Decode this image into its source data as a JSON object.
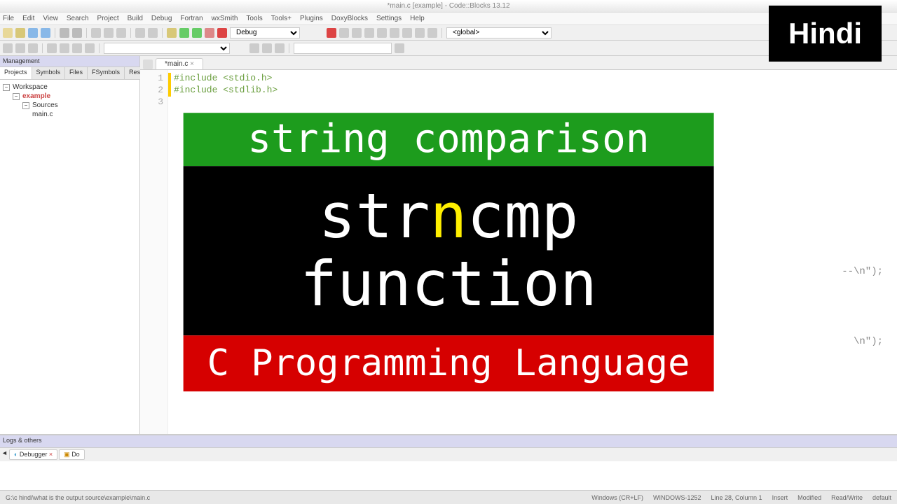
{
  "titlebar": "*main.c [example] - Code::Blocks 13.12",
  "menu": [
    "File",
    "Edit",
    "View",
    "Search",
    "Project",
    "Build",
    "Debug",
    "Fortran",
    "wxSmith",
    "Tools",
    "Tools+",
    "Plugins",
    "DoxyBlocks",
    "Settings",
    "Help"
  ],
  "toolbar": {
    "debug_dropdown": "Debug",
    "global_dropdown": "<global>"
  },
  "sidebar": {
    "header": "Management",
    "tabs": [
      "Projects",
      "Symbols",
      "Files",
      "FSymbols",
      "Resources"
    ],
    "active_tab": 0,
    "tree": {
      "root": "Workspace",
      "project": "example",
      "folder": "Sources",
      "file": "main.c"
    }
  },
  "editor": {
    "tab": "*main.c",
    "lines": [
      "1",
      "2",
      "3"
    ],
    "code": [
      "#include <stdio.h>",
      "#include <stdlib.h>",
      ""
    ]
  },
  "code_fragments": {
    "frag1": "--\\n\");",
    "frag2": "\\n\");"
  },
  "bottom": {
    "header": "Logs & others",
    "tabs": [
      "Debugger",
      "Do"
    ]
  },
  "statusbar": {
    "left": "G:\\c hindi\\what is the output source\\example\\main.c",
    "encoding": "Windows (CR+LF)",
    "charset": "WINDOWS-1252",
    "pos": "Line 28, Column 1",
    "insert": "Insert",
    "modified": "Modified",
    "rw": "Read/Write",
    "profile": "default"
  },
  "overlay": {
    "green": "string comparison",
    "black_pre": "str",
    "black_hl": "n",
    "black_mid": "cmp",
    "black_line2": "function",
    "red": "C Programming Language",
    "badge": "Hindi"
  }
}
